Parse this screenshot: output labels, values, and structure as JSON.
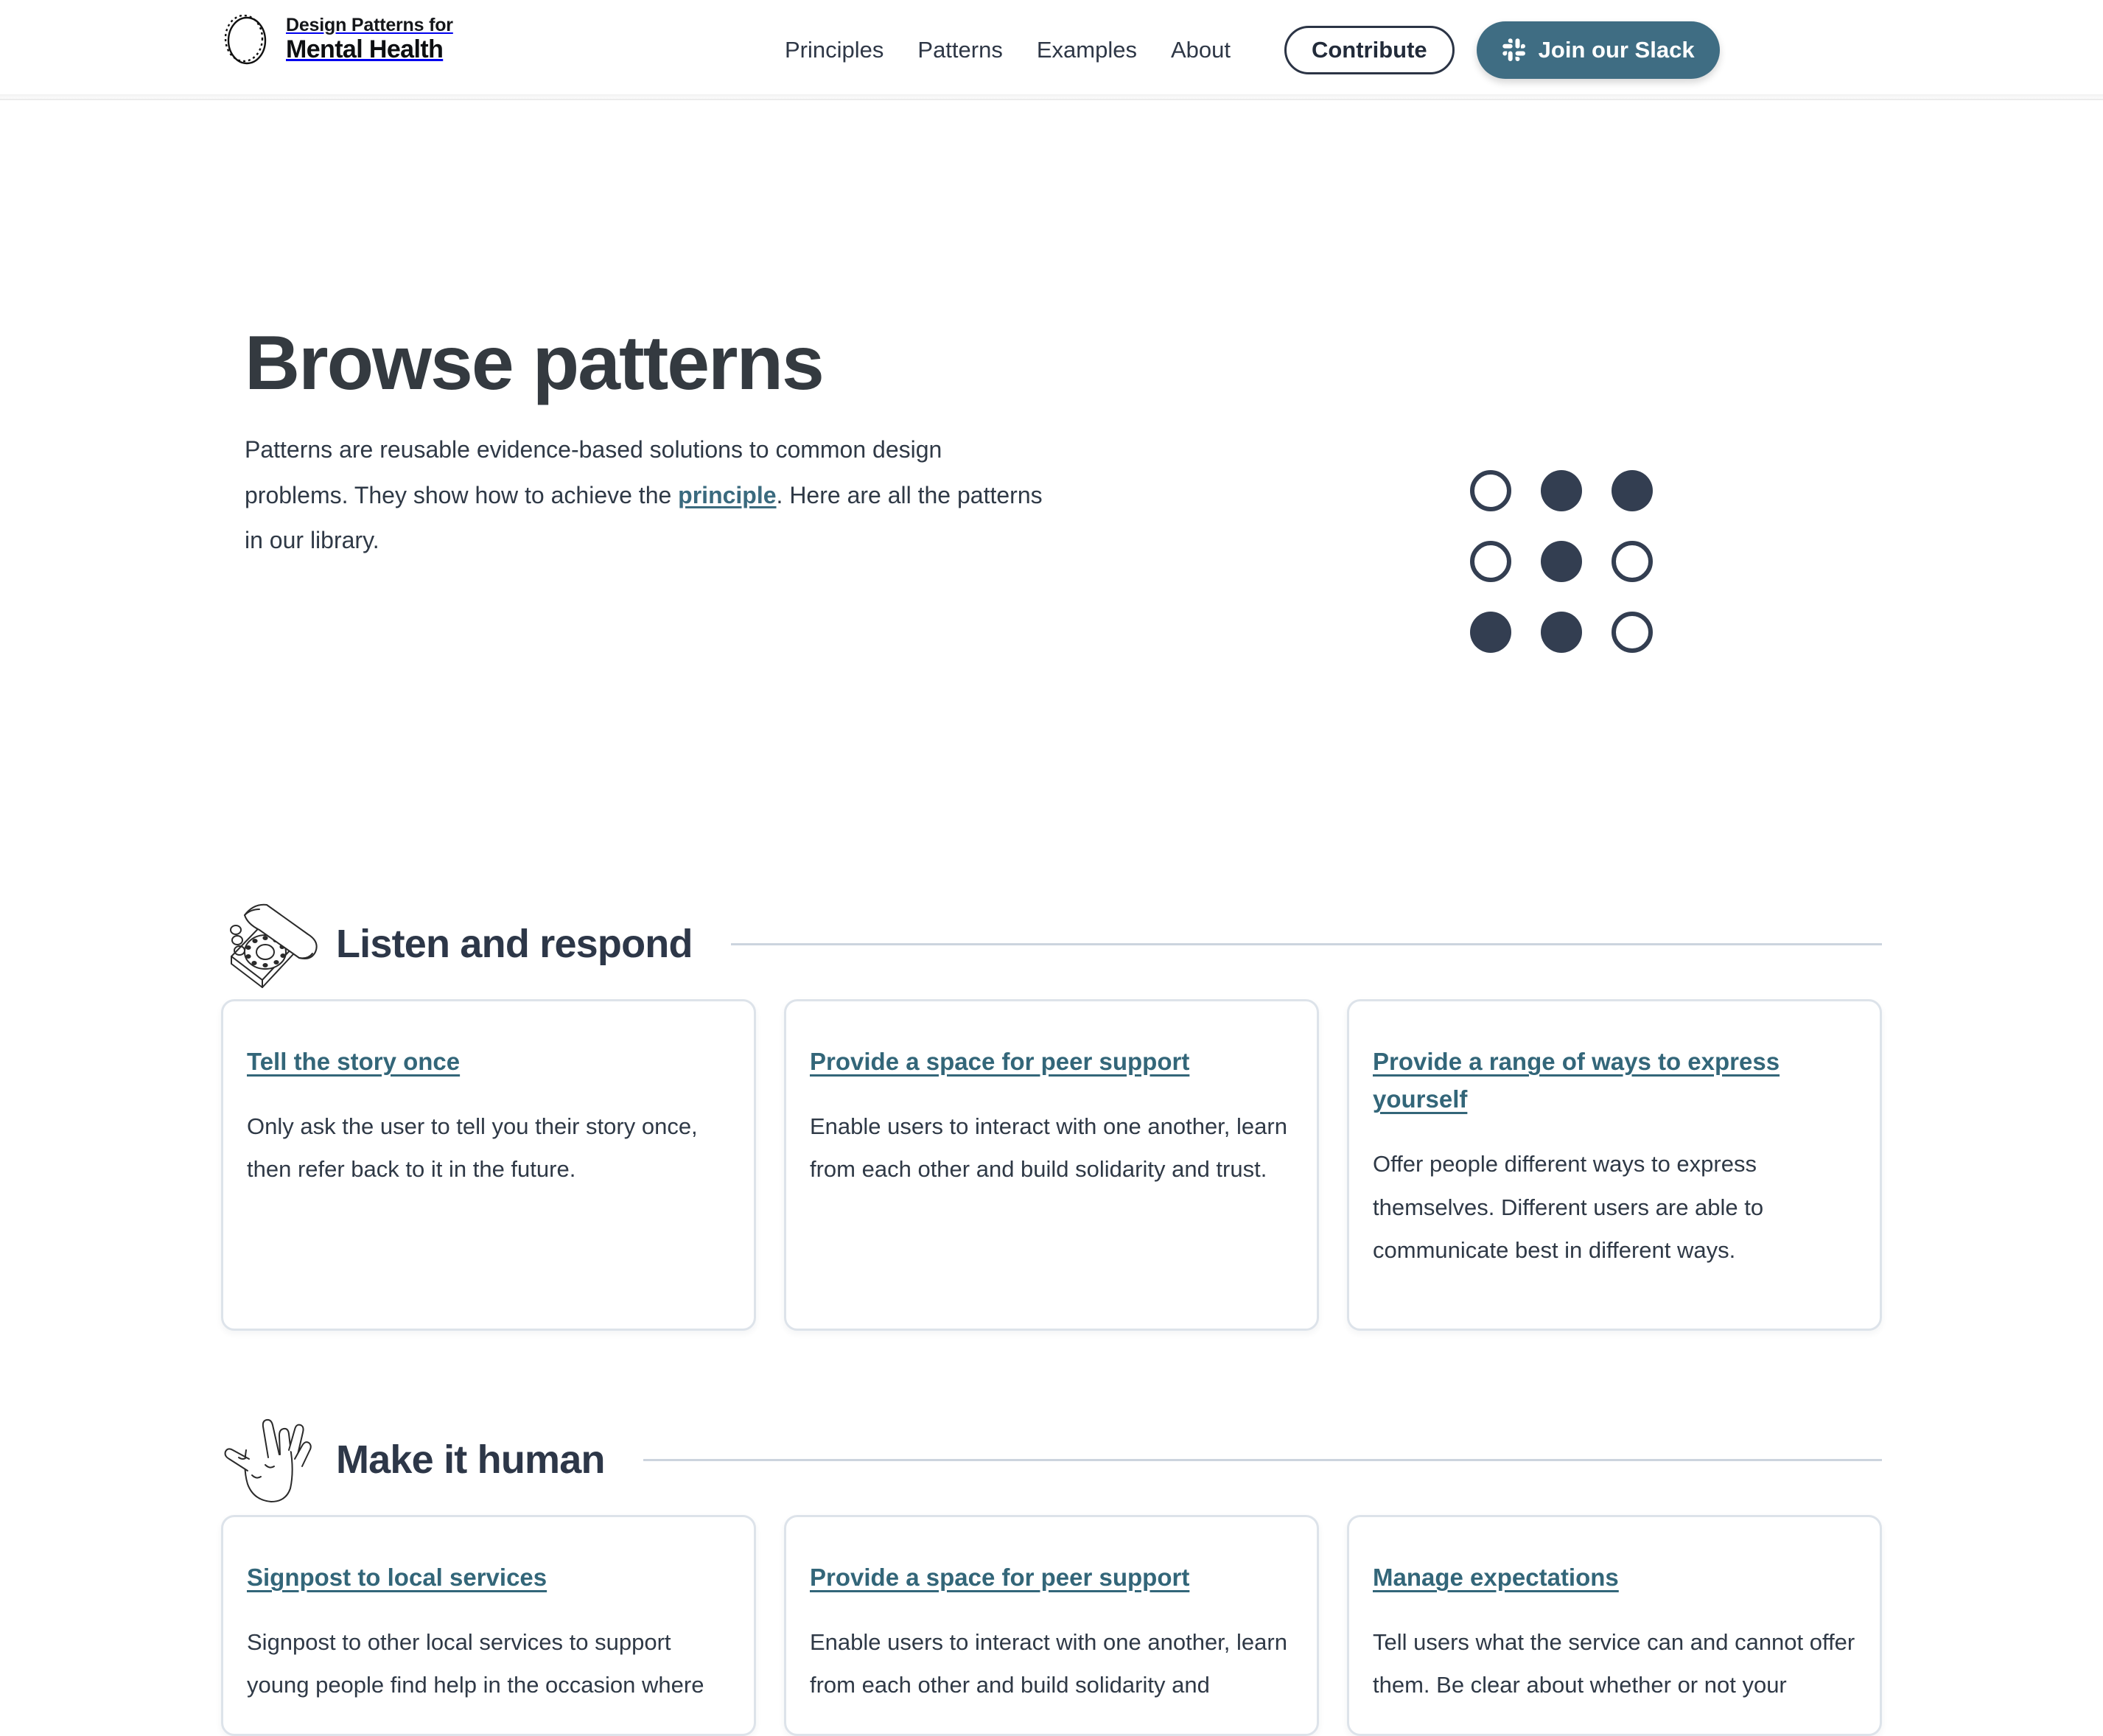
{
  "brand": {
    "line1": "Design Patterns for",
    "line2": "Mental Health",
    "logo_icon": "dotted-circle-logo"
  },
  "nav": {
    "links": [
      {
        "label": "Principles"
      },
      {
        "label": "Patterns"
      },
      {
        "label": "Examples"
      },
      {
        "label": "About"
      }
    ],
    "contribute_label": "Contribute",
    "slack_label": "Join our Slack",
    "slack_icon": "slack-icon"
  },
  "hero": {
    "title": "Browse patterns",
    "body_part1": "Patterns are reusable evidence-based solutions to common design problems. They show how to achieve the ",
    "body_link": "principle",
    "body_part2": ". Here are all the patterns in our library.",
    "dot_grid": [
      "hollow",
      "filled",
      "filled",
      "hollow",
      "filled",
      "hollow",
      "filled",
      "filled",
      "hollow"
    ]
  },
  "sections": [
    {
      "title": "Listen and respond",
      "icon": "rotary-telephone-icon",
      "cards": [
        {
          "title": "Tell the story once",
          "desc": "Only ask the user to tell you their story once, then refer back to it in the future."
        },
        {
          "title": "Provide a space for peer support",
          "desc": "Enable users to interact with one another, learn from each other and build solidarity and trust."
        },
        {
          "title": "Provide a range of ways to express yourself",
          "desc": "Offer people different ways to express themselves. Different users are able to communicate best in different ways."
        }
      ]
    },
    {
      "title": "Make it human",
      "icon": "open-hand-icon",
      "cards": [
        {
          "title": "Signpost to local services",
          "desc": "Signpost to other local services to support young people find help in the occasion where"
        },
        {
          "title": "Provide a space for peer support",
          "desc": "Enable users to interact with one another, learn from each other and build solidarity and"
        },
        {
          "title": "Manage expectations",
          "desc": "Tell users what the service can and cannot offer them. Be clear about whether or not your"
        }
      ]
    }
  ],
  "colors": {
    "accent_teal": "#3f6d83",
    "link_teal": "#336679",
    "navy": "#2d3748",
    "card_border": "#dde3ea",
    "rule": "#ccd4de"
  }
}
